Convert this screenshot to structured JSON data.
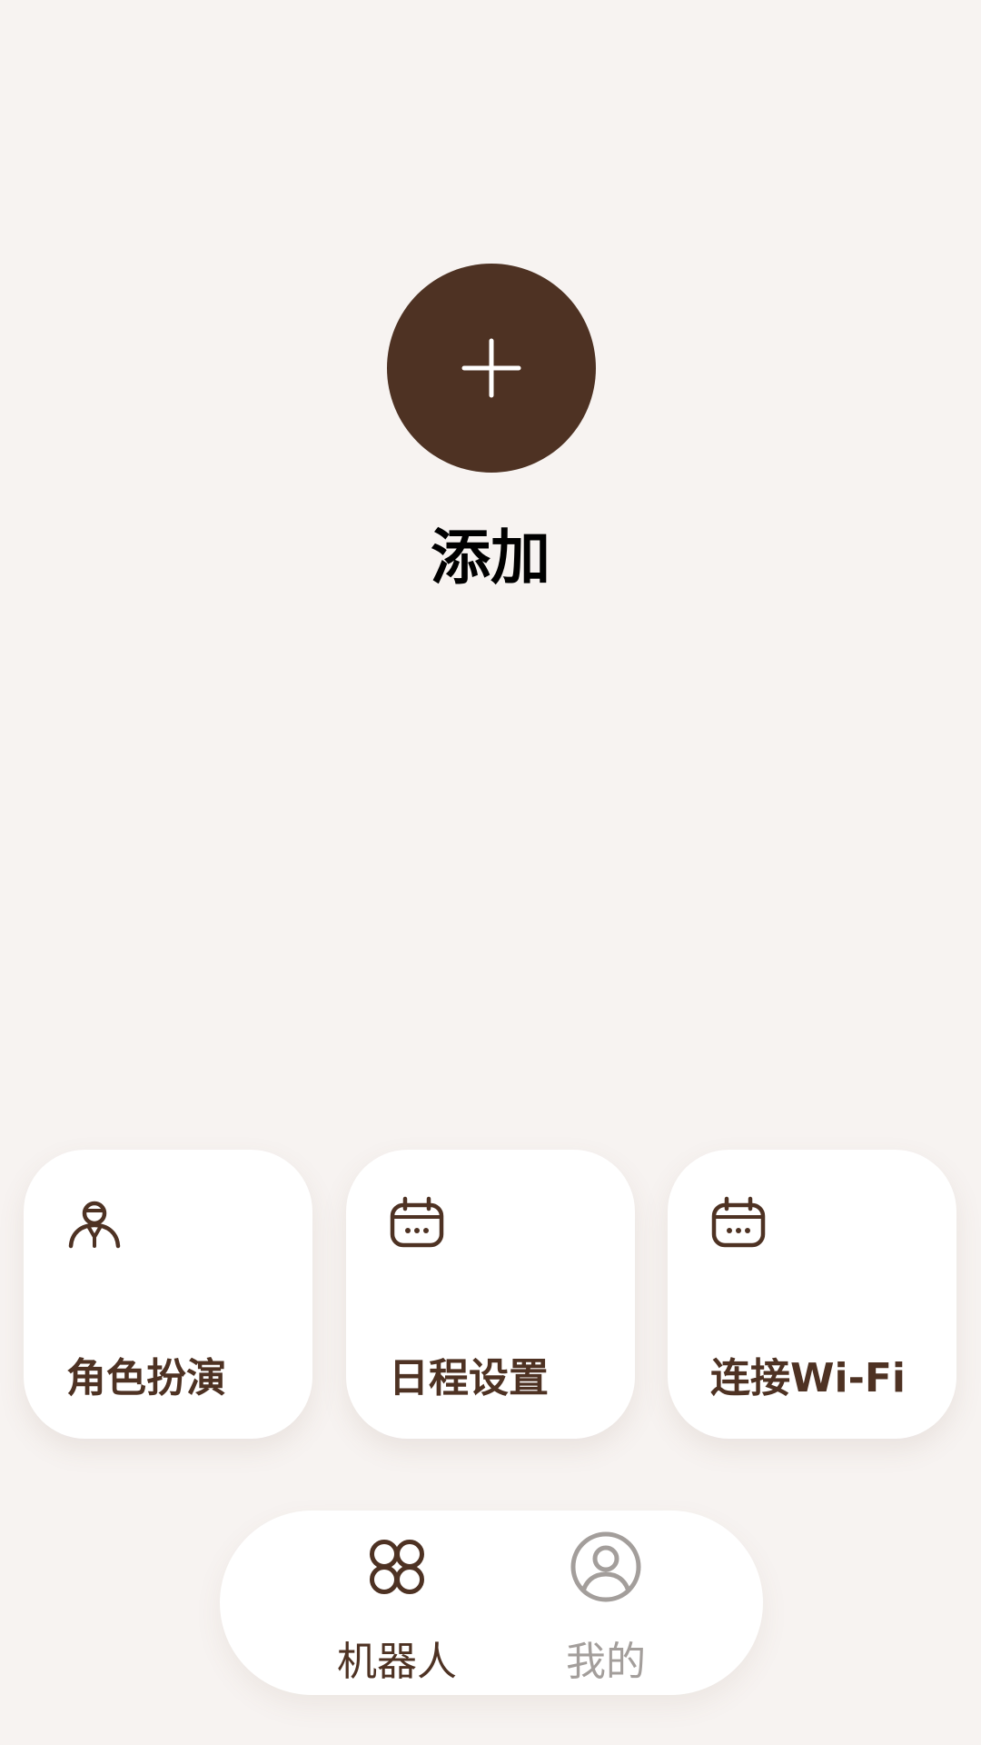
{
  "add": {
    "label": "添加"
  },
  "cards": [
    {
      "label": "角色扮演",
      "icon": "person-icon"
    },
    {
      "label": "日程设置",
      "icon": "calendar-icon"
    },
    {
      "label": "连接Wi-Fi",
      "icon": "calendar-icon"
    }
  ],
  "nav": {
    "items": [
      {
        "label": "机器人",
        "icon": "grid-circles-icon",
        "active": true
      },
      {
        "label": "我的",
        "icon": "user-circle-icon",
        "active": false
      }
    ]
  },
  "colors": {
    "background": "#f7f3f1",
    "accent": "#4e3223",
    "inactive": "#a39e9b",
    "card": "#ffffff"
  }
}
